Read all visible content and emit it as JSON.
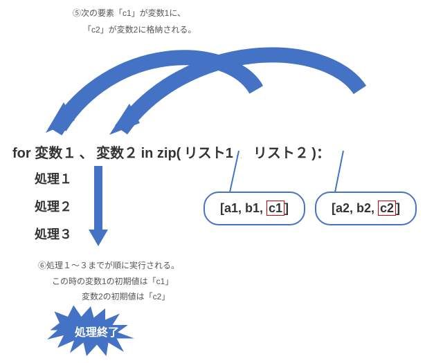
{
  "annotations": {
    "top1": "⑤次の要素「c1」が変数1に、",
    "top2": "「c2」が変数2に格納される。",
    "bottom1": "⑥処理１～３までが順に実行される。",
    "bottom2": "この時の変数1の初期値は「c1」",
    "bottom3": "変数2の初期値は「c2」"
  },
  "code": {
    "for_line_prefix": "for ",
    "var1": "変数１",
    "separator": "、",
    "var2": "変数２",
    "mid": " in zip(",
    "list1": "リスト1",
    "sep2": "、",
    "list2": "リスト２",
    "suffix": ")：",
    "proc1": "処理１",
    "proc2": "処理２",
    "proc3": "処理３"
  },
  "bubbles": {
    "b1": {
      "items": [
        "a1",
        "b1",
        "c1"
      ],
      "highlight_index": 2
    },
    "b2": {
      "items": [
        "a2",
        "b2",
        "c2"
      ],
      "highlight_index": 2
    }
  },
  "star_text": "処理終了",
  "colors": {
    "accent": "#4472c4"
  },
  "chart_data": {
    "type": "diagram",
    "description": "Python for-loop with zip() iterating two lists in parallel; third iteration shown where c1→変数1 and c2→変数2, then 処理1-3 execute and loop ends"
  }
}
